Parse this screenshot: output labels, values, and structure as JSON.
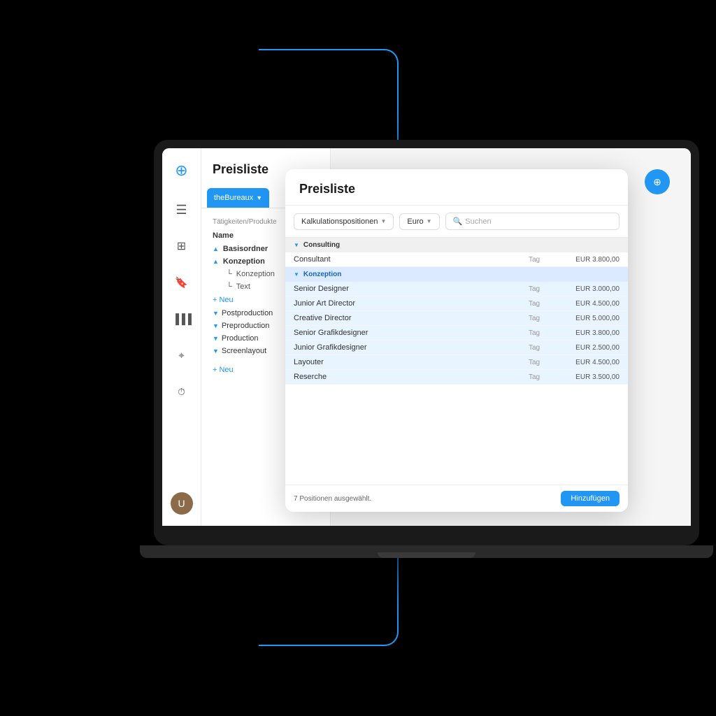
{
  "app": {
    "title": "Preisliste"
  },
  "sidebar": {
    "icons": [
      {
        "name": "logo-icon",
        "symbol": "⊕",
        "active": false
      },
      {
        "name": "menu-icon",
        "symbol": "☰",
        "active": false
      },
      {
        "name": "grid-icon",
        "symbol": "⊞",
        "active": false
      },
      {
        "name": "tag-icon",
        "symbol": "🏷",
        "active": true
      },
      {
        "name": "chart-icon",
        "symbol": "ıll",
        "active": false
      },
      {
        "name": "pin-icon",
        "symbol": "⌖",
        "active": false
      },
      {
        "name": "clock-icon",
        "symbol": "⏱",
        "active": false
      }
    ],
    "avatar_label": "U"
  },
  "left_panel": {
    "title": "Preisliste",
    "tab_label": "theBureaux",
    "subtab_label": "Tätigkeiten/Produkte",
    "column_name": "Name",
    "tree": [
      {
        "label": "Basisordner",
        "type": "bold-arrow",
        "arrow": "▲"
      },
      {
        "label": "Konzeption",
        "type": "bold-arrow",
        "arrow": "▲"
      },
      {
        "label": "Konzeption",
        "type": "sub"
      },
      {
        "label": "Text",
        "type": "sub"
      },
      {
        "label": "+ Neu",
        "type": "new"
      },
      {
        "label": "Postproduction",
        "type": "group",
        "arrow": "▼"
      },
      {
        "label": "Preproduction",
        "type": "group",
        "arrow": "▼"
      },
      {
        "label": "Production",
        "type": "group",
        "arrow": "▼"
      },
      {
        "label": "Screenlayout",
        "type": "group",
        "arrow": "▼"
      }
    ],
    "bottom_new": "+ Neu"
  },
  "modal": {
    "title": "Preisliste",
    "dropdown_kalkulationspositionen": "Kalkulationspositionen",
    "dropdown_euro": "Euro",
    "search_placeholder": "Suchen",
    "sections": [
      {
        "name": "Consulting",
        "active": false,
        "rows": [
          {
            "name": "Consultant",
            "unit": "Tag",
            "price": "EUR 3.800,00",
            "selected": false
          }
        ]
      },
      {
        "name": "Konzeption",
        "active": true,
        "rows": [
          {
            "name": "Senior Designer",
            "unit": "Tag",
            "price": "EUR 3.000,00",
            "selected": true
          },
          {
            "name": "Junior Art Director",
            "unit": "Tag",
            "price": "EUR 4.500,00",
            "selected": true
          },
          {
            "name": "Creative Director",
            "unit": "Tag",
            "price": "EUR 5.000,00",
            "selected": true
          },
          {
            "name": "Senior Grafikdesigner",
            "unit": "Tag",
            "price": "EUR 3.800,00",
            "selected": true
          },
          {
            "name": "Junior Grafikdesigner",
            "unit": "Tag",
            "price": "EUR 2.500,00",
            "selected": true
          },
          {
            "name": "Layouter",
            "unit": "Tag",
            "price": "EUR 4.500,00",
            "selected": true
          },
          {
            "name": "Reserche",
            "unit": "Tag",
            "price": "EUR 3.500,00",
            "selected": true
          }
        ]
      }
    ],
    "footer": {
      "count_label": "7 Positionen ausgewählt.",
      "button_label": "Hinzufügen"
    }
  },
  "colors": {
    "accent": "#2196F3",
    "selected_bg": "#e8f4ff",
    "active_section_bg": "#dbeafe"
  }
}
